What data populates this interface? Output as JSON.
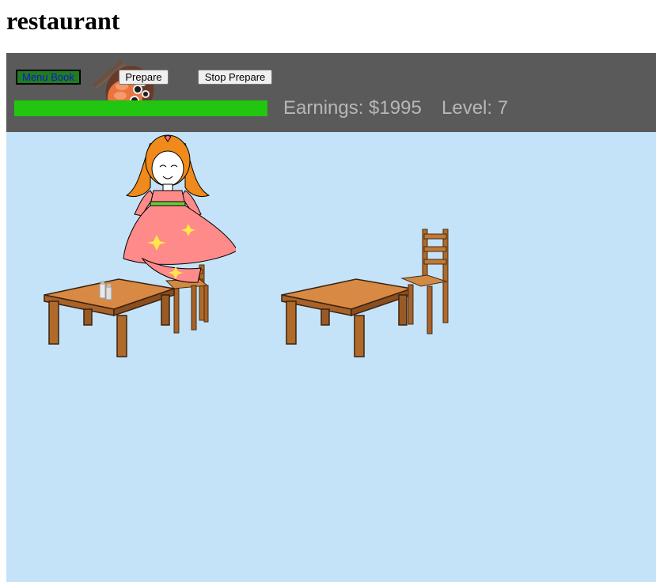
{
  "page": {
    "title": "restaurant"
  },
  "toolbar": {
    "menu_book_label": "Menu Book",
    "prepare_label": "Prepare",
    "stop_prepare_label": "Stop Prepare",
    "progress_fraction": 1.0,
    "earnings_text": "Earnings: $1995",
    "level_text": "Level: 7"
  },
  "colors": {
    "toolbar_bg": "#5a5a5a",
    "floor_bg": "#c4e3f8",
    "progress_fill": "#22c50f",
    "menu_book_bg": "#1e7d1e",
    "menu_book_text": "#1515d0",
    "stats_text": "#b7b7b7"
  },
  "sprites": [
    "sushi-platter-icon",
    "waitress-icon",
    "table-icon",
    "chair-icon",
    "salt-shaker-icon"
  ]
}
